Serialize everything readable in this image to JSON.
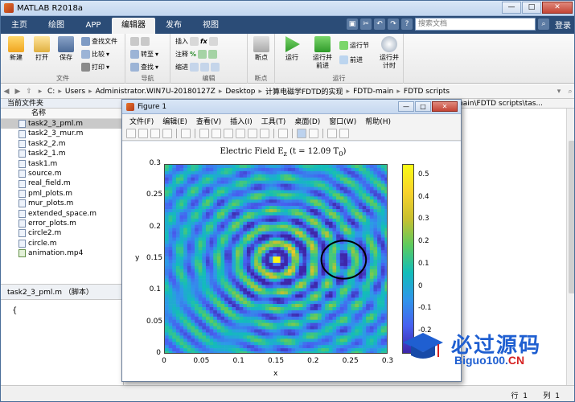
{
  "app": {
    "title": "MATLAB R2018a"
  },
  "tabs": [
    {
      "label": "主页"
    },
    {
      "label": "绘图"
    },
    {
      "label": "APP"
    },
    {
      "label": "编辑器"
    },
    {
      "label": "发布"
    },
    {
      "label": "视图"
    }
  ],
  "topright": {
    "search_placeholder": "搜索文档",
    "login_label": "登录"
  },
  "ribbon": {
    "file_group": {
      "label": "文件",
      "new": "新建",
      "open": "打开",
      "save": "保存",
      "find_files": "查找文件",
      "compare": "比较",
      "print": "打印"
    },
    "nav_group": {
      "label": "导航",
      "goto": "转至",
      "find": "查找"
    },
    "edit_group": {
      "label": "编辑",
      "insert": "插入",
      "comment": "注释",
      "indent": "缩进"
    },
    "breakpoint_group": {
      "label": "断点",
      "breakpoints": "断点"
    },
    "run_group": {
      "label": "运行",
      "run": "运行",
      "run_advance": "运行并\n前进",
      "run_section": "运行节",
      "advance": "前进",
      "run_time": "运行并\n计时"
    }
  },
  "address": {
    "crumbs": [
      "C:",
      "Users",
      "Administrator.WIN7U-20180127Z",
      "Desktop",
      "计算电磁学FDTD的实现",
      "FDTD-main",
      "FDTD scripts"
    ]
  },
  "current_folder": {
    "title": "当前文件夹",
    "column": "名称",
    "files": [
      {
        "name": "task2_3_pml.m",
        "selected": true,
        "icon": "m-file-icon"
      },
      {
        "name": "task2_3_mur.m",
        "icon": "m-file-icon"
      },
      {
        "name": "task2_2.m",
        "icon": "m-file-icon"
      },
      {
        "name": "task2_1.m",
        "icon": "m-file-icon"
      },
      {
        "name": "task1.m",
        "icon": "m-file-icon"
      },
      {
        "name": "source.m",
        "icon": "m-file-icon"
      },
      {
        "name": "real_field.m",
        "icon": "m-file-icon"
      },
      {
        "name": "pml_plots.m",
        "icon": "m-file-icon"
      },
      {
        "name": "mur_plots.m",
        "icon": "m-file-icon"
      },
      {
        "name": "extended_space.m",
        "icon": "m-file-icon"
      },
      {
        "name": "error_plots.m",
        "icon": "m-file-icon"
      },
      {
        "name": "circle2.m",
        "icon": "m-file-icon"
      },
      {
        "name": "circle.m",
        "icon": "m-file-icon"
      },
      {
        "name": "animation.mp4",
        "icon": "video-file-icon"
      }
    ]
  },
  "details": {
    "label": "task2_3_pml.m  （脚本）"
  },
  "editor": {
    "content": "{"
  },
  "right_pane": {
    "path": "main\\FDTD scripts\\tas..."
  },
  "status": {
    "row_label": "行",
    "row_value": "1",
    "col_label": "列",
    "col_value": "1"
  },
  "figure": {
    "title": "Figure 1",
    "menu": [
      "文件(F)",
      "编辑(E)",
      "查看(V)",
      "插入(I)",
      "工具(T)",
      "桌面(D)",
      "窗口(W)",
      "帮助(H)"
    ],
    "plot_title": "Electric Field E",
    "plot_title_sub": "z",
    "plot_title_rest": " (t = 12.09 T",
    "plot_title_sub2": "0",
    "plot_title_end": ")",
    "xlabel": "x",
    "ylabel": "y",
    "xticks": [
      "0",
      "0.05",
      "0.1",
      "0.15",
      "0.2",
      "0.25",
      "0.3"
    ],
    "yticks": [
      "0.3",
      "0.25",
      "0.2",
      "0.15",
      "0.1",
      "0.05",
      "0"
    ],
    "cbticks": [
      "0.5",
      "0.4",
      "0.3",
      "0.2",
      "0.1",
      "0",
      "-0.1",
      "-0.2"
    ]
  },
  "chart_data": {
    "type": "heatmap",
    "title": "Electric Field Ez (t = 12.09 T0)",
    "xlabel": "x",
    "ylabel": "y",
    "xlim": [
      0,
      0.3
    ],
    "ylim": [
      0,
      0.3
    ],
    "clim": [
      -0.3,
      0.55
    ],
    "colormap": "parula",
    "source_point": {
      "x": 0.15,
      "y": 0.15
    },
    "circle_center": {
      "x": 0.24,
      "y": 0.15
    },
    "circle_radius": 0.03
  },
  "watermark": {
    "title": "必过源码",
    "sub": "Biguo100.",
    "sub_red": "CN"
  },
  "colors": {
    "tabbar": "#2b4c77",
    "accent": "#1f5fd1"
  }
}
